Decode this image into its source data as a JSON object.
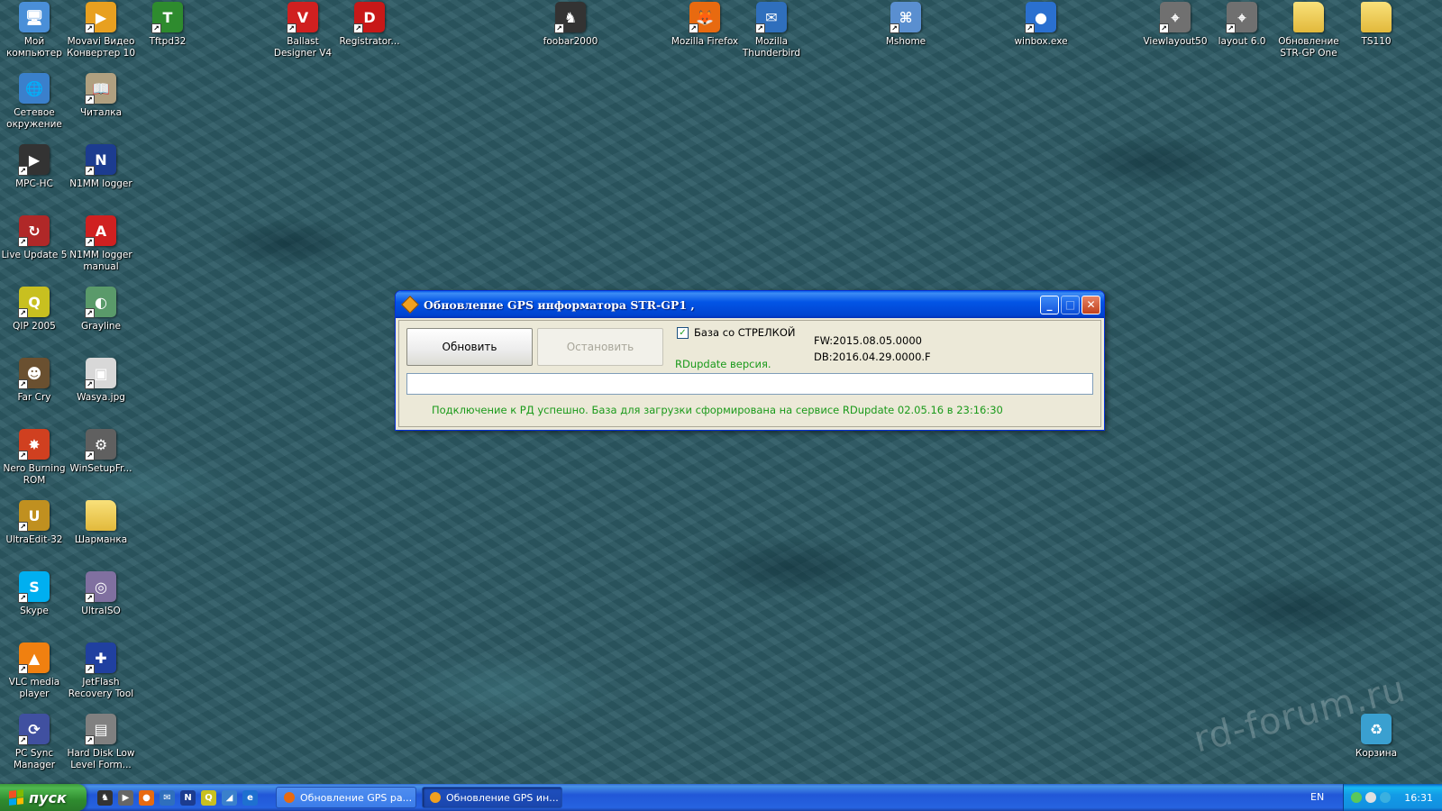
{
  "desktop_icons": [
    {
      "label": "Мой компьютер",
      "icon": "my-computer-icon",
      "color": "#4a8fd8",
      "glyph": "🖥"
    },
    {
      "label": "Movavi Видео Конвертер 10",
      "icon": "movavi-icon",
      "color": "#e8a020",
      "glyph": "▶"
    },
    {
      "label": "Tftpd32",
      "icon": "tftpd32-icon",
      "color": "#2e8b2e",
      "glyph": "T"
    },
    {
      "label": "Ballast Designer V4",
      "icon": "ballast-icon",
      "color": "#d02020",
      "glyph": "V"
    },
    {
      "label": "Registrator...",
      "icon": "registrator-icon",
      "color": "#c81818",
      "glyph": "D"
    },
    {
      "label": "foobar2000",
      "icon": "foobar-icon",
      "color": "#333333",
      "glyph": "♞"
    },
    {
      "label": "Mozilla Firefox",
      "icon": "firefox-icon",
      "color": "#e86a10",
      "glyph": "🦊"
    },
    {
      "label": "Mozilla Thunderbird",
      "icon": "thunderbird-icon",
      "color": "#2f6fbd",
      "glyph": "✉"
    },
    {
      "label": "Mshome",
      "icon": "network-icon",
      "color": "#5a8fd0",
      "glyph": "⌘"
    },
    {
      "label": "winbox.exe",
      "icon": "winbox-icon",
      "color": "#2a70d0",
      "glyph": "●"
    },
    {
      "label": "Viewlayout50",
      "icon": "viewlayout-icon",
      "color": "#707070",
      "glyph": "⌖"
    },
    {
      "label": "layout 6.0",
      "icon": "layout-icon",
      "color": "#707070",
      "glyph": "⌖"
    },
    {
      "label": "Обновление STR-GP One",
      "icon": "folder-icon",
      "color": "folder",
      "glyph": ""
    },
    {
      "label": "TS110",
      "icon": "folder-icon",
      "color": "folder",
      "glyph": ""
    },
    {
      "label": "Сетевое окружение",
      "icon": "network-places-icon",
      "color": "#3a80cc",
      "glyph": "🌐"
    },
    {
      "label": "Читалка",
      "icon": "reader-icon",
      "color": "#b0a080",
      "glyph": "📖"
    },
    {
      "label": "MPC-HC",
      "icon": "mpc-hc-icon",
      "color": "#333333",
      "glyph": "▶"
    },
    {
      "label": "N1MM logger",
      "icon": "n1mm-icon",
      "color": "#1c3c90",
      "glyph": "N"
    },
    {
      "label": "Live Update 5",
      "icon": "live-update-icon",
      "color": "#b02828",
      "glyph": "↻"
    },
    {
      "label": "N1MM logger manual",
      "icon": "pdf-icon",
      "color": "#d02020",
      "glyph": "A"
    },
    {
      "label": "QIP 2005",
      "icon": "qip-icon",
      "color": "#c8c020",
      "glyph": "Q"
    },
    {
      "label": "Grayline",
      "icon": "grayline-icon",
      "color": "#5a9a6a",
      "glyph": "◐"
    },
    {
      "label": "Far Cry",
      "icon": "farcry-icon",
      "color": "#6a5030",
      "glyph": "☻"
    },
    {
      "label": "Wasya.jpg",
      "icon": "image-file-icon",
      "color": "#d8d8d8",
      "glyph": "▣"
    },
    {
      "label": "Nero Burning ROM",
      "icon": "nero-icon",
      "color": "#d04020",
      "glyph": "✸"
    },
    {
      "label": "WinSetupFr...",
      "icon": "winsetup-icon",
      "color": "#606060",
      "glyph": "⚙"
    },
    {
      "label": "UltraEdit-32",
      "icon": "ultraedit-icon",
      "color": "#c09020",
      "glyph": "U"
    },
    {
      "label": "Шарманка",
      "icon": "folder-icon",
      "color": "folder",
      "glyph": ""
    },
    {
      "label": "Skype",
      "icon": "skype-icon",
      "color": "#00aff0",
      "glyph": "S"
    },
    {
      "label": "UltraISO",
      "icon": "ultraiso-icon",
      "color": "#8070a0",
      "glyph": "◎"
    },
    {
      "label": "VLC media player",
      "icon": "vlc-icon",
      "color": "#f08010",
      "glyph": "▲"
    },
    {
      "label": "JetFlash Recovery Tool",
      "icon": "jetflash-icon",
      "color": "#2040a0",
      "glyph": "✚"
    },
    {
      "label": "PC Sync Manager",
      "icon": "pc-sync-icon",
      "color": "#4050a0",
      "glyph": "⟳"
    },
    {
      "label": "Hard Disk Low Level Form...",
      "icon": "hdd-format-icon",
      "color": "#808080",
      "glyph": "▤"
    },
    {
      "label": "Корзина",
      "icon": "recycle-bin-icon",
      "color": "#3aa0d0",
      "glyph": "♻"
    }
  ],
  "window": {
    "title": "Обновление GPS информатора STR-GP1 ,",
    "update_button": "Обновить",
    "stop_button": "Остановить",
    "checkbox_label": "База со СТРЕЛКОЙ",
    "checkbox_checked": true,
    "version_label": "RDupdate версия.",
    "fw": "FW:2015.08.05.0000",
    "db": "DB:2016.04.29.0000.F",
    "progress": 0,
    "status": "Подключение к РД успешно. База для загрузки сформирована на сервисе RDupdate 02.05.16 в 23:16:30"
  },
  "taskbar": {
    "start_label": "пуск",
    "tasks": [
      {
        "label": "Обновление GPS ра...",
        "active": false,
        "color": "#e86a10"
      },
      {
        "label": "Обновление GPS ин...",
        "active": true,
        "color": "#f0a020"
      }
    ],
    "language": "EN",
    "clock": "16:31"
  },
  "watermark": "rd-forum.ru",
  "colors": {
    "accent": "#0055e5",
    "status_green": "#1a9a1a"
  }
}
